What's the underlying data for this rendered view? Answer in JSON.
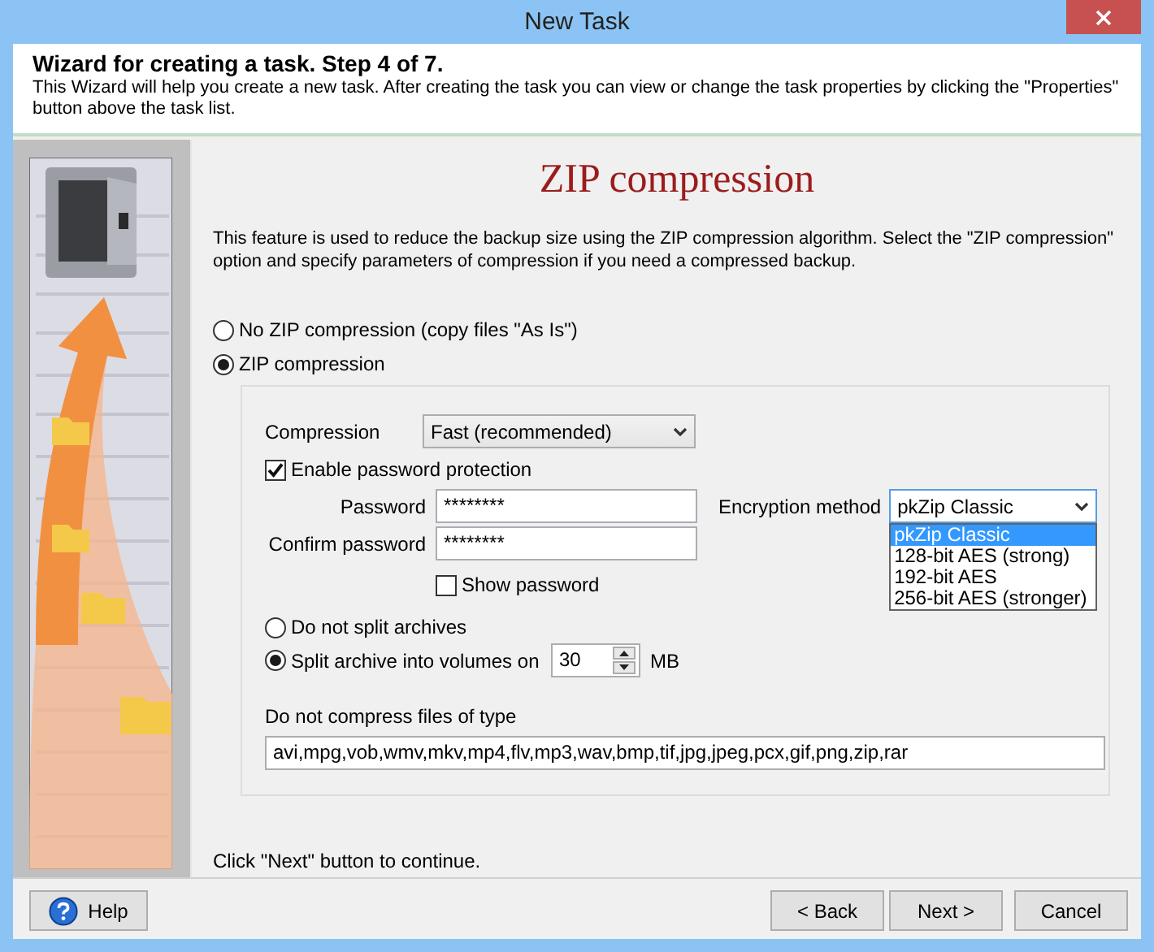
{
  "window": {
    "title": "New Task"
  },
  "header": {
    "title": "Wizard for creating a task. Step 4 of 7.",
    "description": "This Wizard will help you create a new task. After creating the task you can view or change the task properties by clicking the \"Properties\" button above the task list."
  },
  "page": {
    "heading": "ZIP compression",
    "intro": "This feature is used to reduce the backup size using the ZIP compression algorithm. Select the \"ZIP compression\" option and specify parameters of compression if you need a compressed backup.",
    "mode_options": [
      {
        "label": "No ZIP compression (copy files \"As Is\")",
        "selected": false
      },
      {
        "label": "ZIP compression",
        "selected": true
      }
    ],
    "compression": {
      "label": "Compression",
      "value": "Fast (recommended)"
    },
    "password_protection": {
      "label": "Enable password protection",
      "checked": true
    },
    "password": {
      "label": "Password",
      "value": "********"
    },
    "confirm_password": {
      "label": "Confirm password",
      "value": "********"
    },
    "show_password": {
      "label": "Show password",
      "checked": false
    },
    "encryption": {
      "label": "Encryption method",
      "value": "pkZip Classic",
      "expanded": true,
      "options": [
        {
          "label": "pkZip Classic",
          "selected": true
        },
        {
          "label": "128-bit  AES (strong)",
          "selected": false
        },
        {
          "label": "192-bit  AES",
          "selected": false
        },
        {
          "label": "256-bit  AES (stronger)",
          "selected": false
        }
      ]
    },
    "split_options": [
      {
        "label": "Do not split archives",
        "selected": false
      },
      {
        "label": "Split archive into volumes on",
        "selected": true
      }
    ],
    "volume_size": {
      "value": "30",
      "unit": "MB"
    },
    "exclude": {
      "label": "Do not compress files of type",
      "value": "avi,mpg,vob,wmv,mkv,mp4,flv,mp3,wav,bmp,tif,jpg,jpeg,pcx,gif,png,zip,rar"
    },
    "footer_note": "Click \"Next\" button to continue."
  },
  "buttons": [
    {
      "label": "Help",
      "kind": "help"
    },
    {
      "label": "< Back",
      "kind": "plain"
    },
    {
      "label": "Next >",
      "kind": "plain"
    },
    {
      "label": "Cancel",
      "kind": "plain"
    }
  ]
}
